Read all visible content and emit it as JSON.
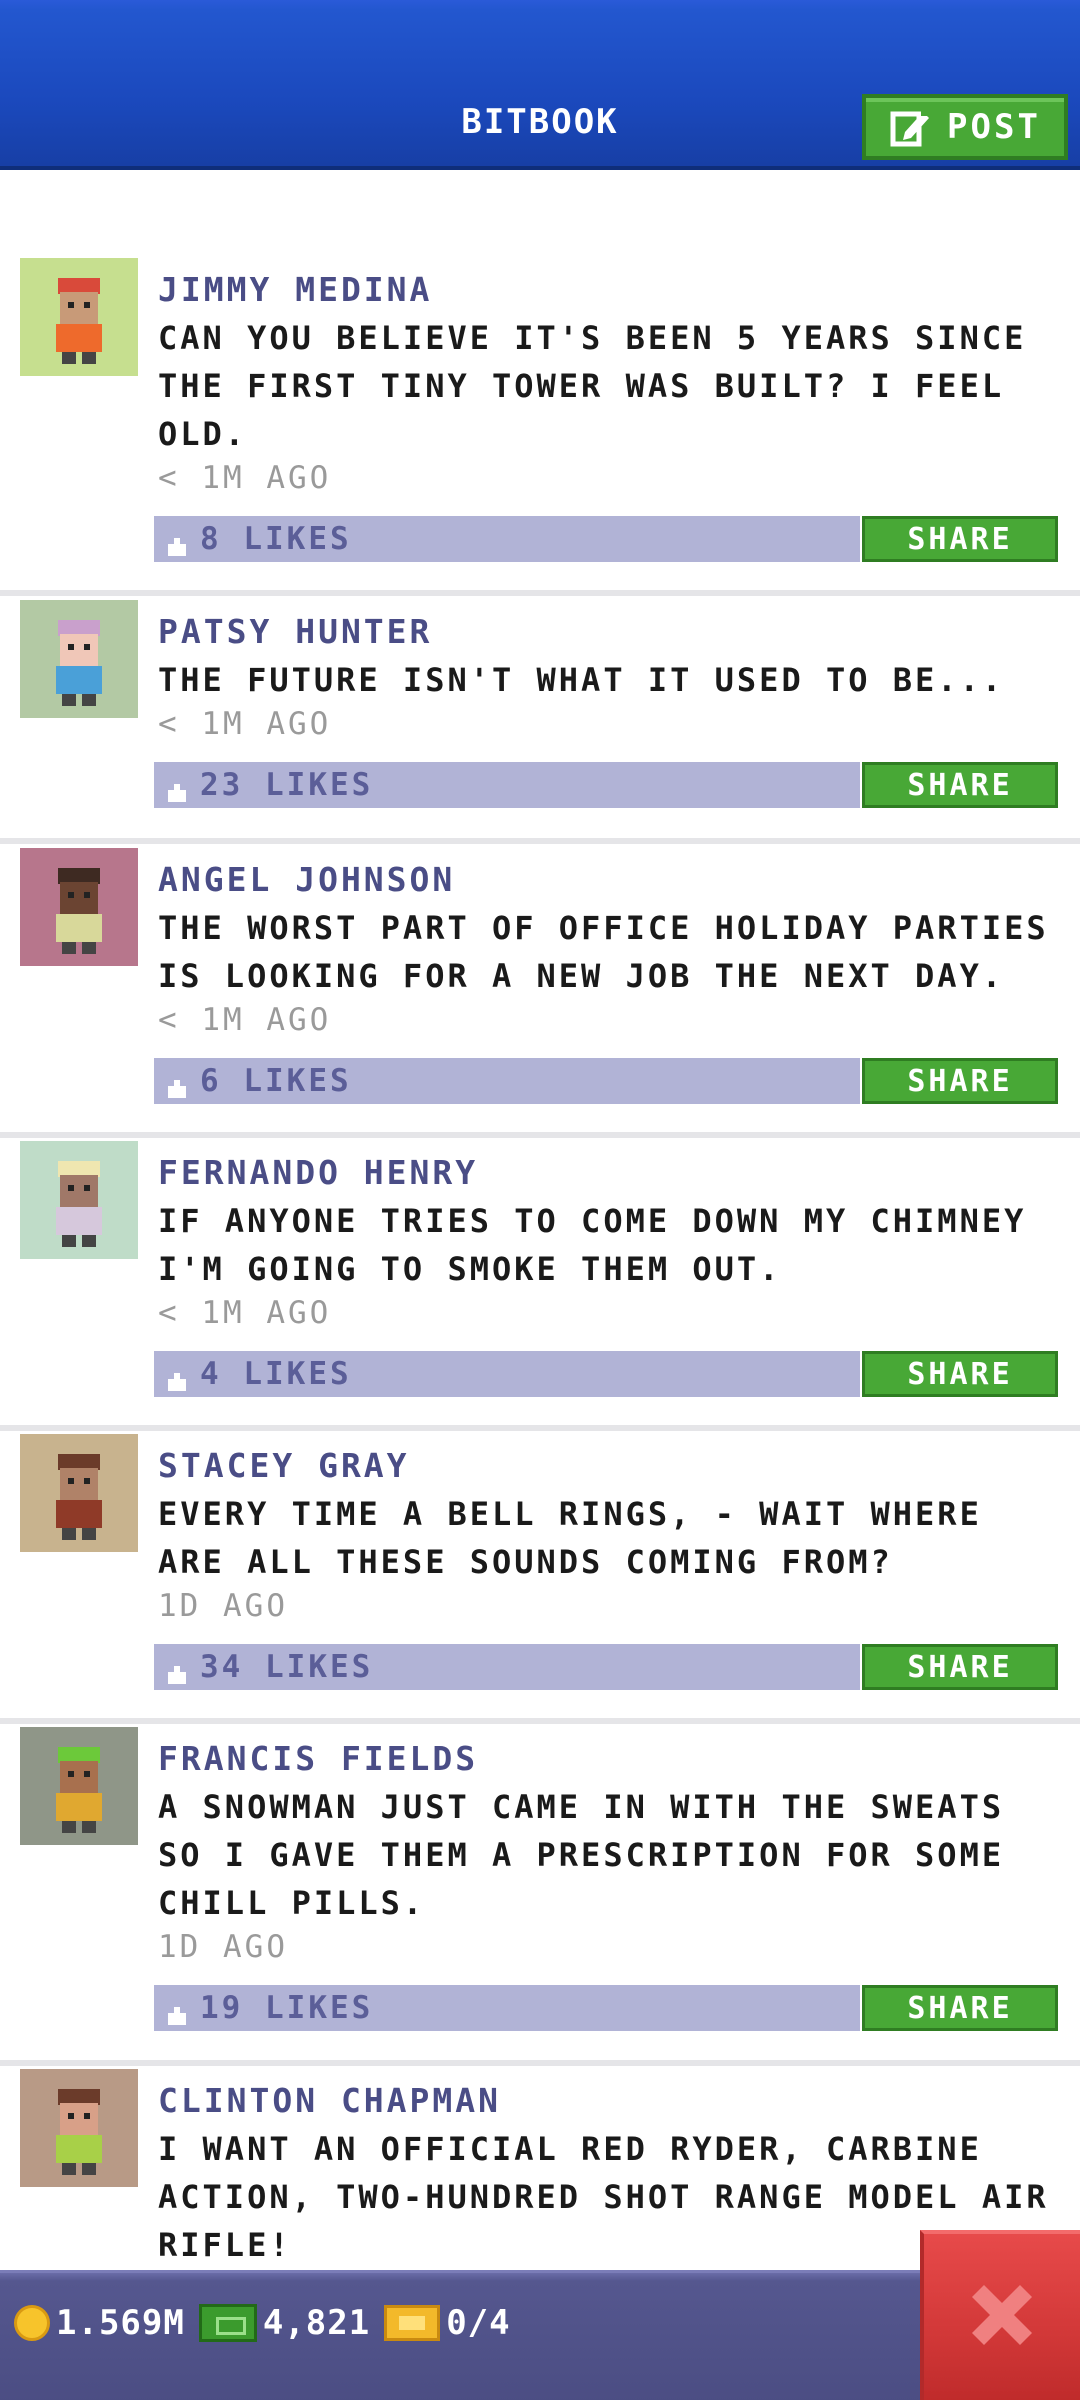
{
  "header": {
    "title": "BITBOOK",
    "post_label": "POST",
    "post_icon": "compose-icon",
    "color": "#1b49bd"
  },
  "posts": [
    {
      "name": "JIMMY MEDINA",
      "text": "CAN YOU BELIEVE IT'S BEEN 5 YEARS SINCE THE FIRST TINY TOWER WAS BUILT? I FEEL OLD.",
      "time": "< 1M AGO",
      "likes": "8 LIKES",
      "share": "SHARE",
      "avatar_bg": "#c6df8f",
      "hair": "#d94a3a",
      "shirt": "#ee6a2c",
      "skin": "#c89a78"
    },
    {
      "name": "PATSY HUNTER",
      "text": "THE FUTURE ISN'T WHAT IT USED TO BE...",
      "time": "< 1M AGO",
      "likes": "23 LIKES",
      "share": "SHARE",
      "avatar_bg": "#b3c9a4",
      "hair": "#c9a0cc",
      "shirt": "#4aa0d8",
      "skin": "#f0c7b8"
    },
    {
      "name": "ANGEL JOHNSON",
      "text": "THE WORST PART OF OFFICE HOLIDAY PARTIES IS LOOKING FOR A NEW JOB THE NEXT DAY.",
      "time": "< 1M AGO",
      "likes": "6 LIKES",
      "share": "SHARE",
      "avatar_bg": "#b7768c",
      "hair": "#3e2a22",
      "shirt": "#d8d89a",
      "skin": "#6b4432"
    },
    {
      "name": "FERNANDO HENRY",
      "text": "IF ANYONE TRIES TO COME DOWN MY CHIMNEY I'M GOING TO SMOKE THEM OUT.",
      "time": "< 1M AGO",
      "likes": "4 LIKES",
      "share": "SHARE",
      "avatar_bg": "#bfdcc8",
      "hair": "#efe6b0",
      "shirt": "#d6c8dc",
      "skin": "#a07868"
    },
    {
      "name": "STACEY GRAY",
      "text": "EVERY TIME A BELL RINGS, - WAIT WHERE ARE ALL THESE SOUNDS COMING FROM?",
      "time": "1D AGO",
      "likes": "34 LIKES",
      "share": "SHARE",
      "avatar_bg": "#c8b38e",
      "hair": "#6b3b2a",
      "shirt": "#8f3a28",
      "skin": "#b08268"
    },
    {
      "name": "FRANCIS FIELDS",
      "text": "A SNOWMAN JUST CAME IN WITH THE SWEATS SO I GAVE THEM A PRESCRIPTION FOR SOME CHILL PILLS.",
      "time": "1D AGO",
      "likes": "19 LIKES",
      "share": "SHARE",
      "avatar_bg": "#8f9688",
      "hair": "#6cc93a",
      "shirt": "#e0a830",
      "skin": "#a8704e"
    },
    {
      "name": "CLINTON CHAPMAN",
      "text": "I WANT AN OFFICIAL RED RYDER, CARBINE ACTION, TWO-HUNDRED SHOT RANGE MODEL AIR RIFLE!",
      "time": "",
      "likes": "",
      "share": "",
      "avatar_bg": "#b89a86",
      "hair": "#6b3b2a",
      "shirt": "#a8d048",
      "skin": "#d8a088"
    }
  ],
  "footer": {
    "coins": "1.569M",
    "bux": "4,821",
    "tickets": "0/4",
    "close_icon": "close-icon"
  }
}
